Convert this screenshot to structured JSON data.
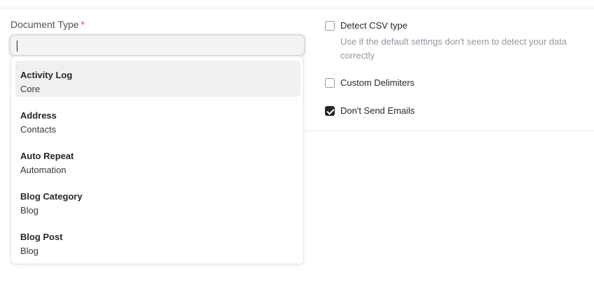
{
  "document_type": {
    "label": "Document Type",
    "required_mark": "*",
    "value": ""
  },
  "dropdown": {
    "options": [
      {
        "title": "Activity Log",
        "subtitle": "Core"
      },
      {
        "title": "Address",
        "subtitle": "Contacts"
      },
      {
        "title": "Auto Repeat",
        "subtitle": "Automation"
      },
      {
        "title": "Blog Category",
        "subtitle": "Blog"
      },
      {
        "title": "Blog Post",
        "subtitle": "Blog"
      }
    ]
  },
  "settings": {
    "detect_csv": {
      "label": "Detect CSV type",
      "checked": false,
      "help": "Use if the default settings don't seem to detect your data correctly"
    },
    "custom_delimiters": {
      "label": "Custom Delimiters",
      "checked": false
    },
    "dont_send_emails": {
      "label": "Don't Send Emails",
      "checked": true
    }
  }
}
